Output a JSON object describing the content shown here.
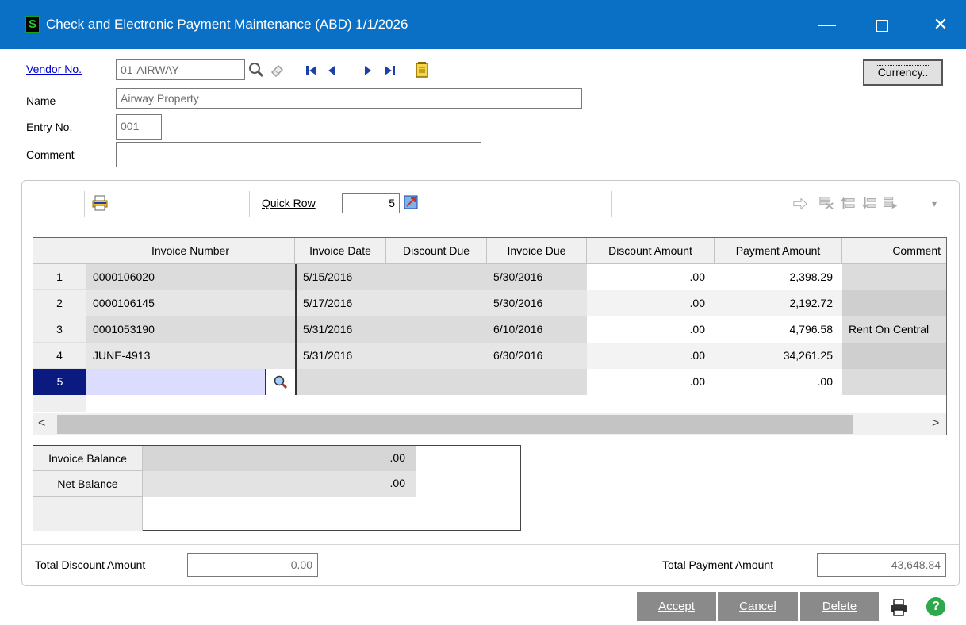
{
  "window": {
    "app_icon": "S",
    "title": "Check and Electronic Payment Maintenance (ABD) 1/1/2026",
    "minimize_glyph": "—",
    "close_glyph": "✕"
  },
  "header": {
    "vendor_label": "Vendor No.",
    "vendor_value": "01-AIRWAY",
    "name_label": "Name",
    "name_value": "Airway Property",
    "entry_label": "Entry No.",
    "entry_value": "001",
    "comment_label": "Comment",
    "comment_value": "",
    "currency_button": "Currency.."
  },
  "toolbar": {
    "quick_row_label": "Quick Row",
    "quick_row_value": "5",
    "dropdown_glyph": "▾"
  },
  "grid": {
    "columns": [
      "Invoice Number",
      "Invoice Date",
      "Discount Due",
      "Invoice Due",
      "Discount Amount",
      "Payment Amount",
      "Comment"
    ],
    "rows": [
      {
        "num": "1",
        "invoice_number": "0000106020",
        "invoice_date": "5/15/2016",
        "discount_due": "",
        "invoice_due": "5/30/2016",
        "discount_amount": ".00",
        "payment_amount": "2,398.29",
        "comment": ""
      },
      {
        "num": "2",
        "invoice_number": "0000106145",
        "invoice_date": "5/17/2016",
        "discount_due": "",
        "invoice_due": "5/30/2016",
        "discount_amount": ".00",
        "payment_amount": "2,192.72",
        "comment": ""
      },
      {
        "num": "3",
        "invoice_number": "0001053190",
        "invoice_date": "5/31/2016",
        "discount_due": "",
        "invoice_due": "6/10/2016",
        "discount_amount": ".00",
        "payment_amount": "4,796.58",
        "comment": "Rent On Central"
      },
      {
        "num": "4",
        "invoice_number": "JUNE-4913",
        "invoice_date": "5/31/2016",
        "discount_due": "",
        "invoice_due": "6/30/2016",
        "discount_amount": ".00",
        "payment_amount": "34,261.25",
        "comment": ""
      },
      {
        "num": "5",
        "invoice_number": "",
        "invoice_date": "",
        "discount_due": "",
        "invoice_due": "",
        "discount_amount": ".00",
        "payment_amount": ".00",
        "comment": ""
      }
    ],
    "scroll_left": "<",
    "scroll_right": ">"
  },
  "balances": {
    "invoice_balance_label": "Invoice Balance",
    "invoice_balance_value": ".00",
    "net_balance_label": "Net Balance",
    "net_balance_value": ".00"
  },
  "totals": {
    "total_discount_label": "Total Discount Amount",
    "total_discount_value": "0.00",
    "total_payment_label": "Total Payment Amount",
    "total_payment_value": "43,648.84"
  },
  "buttons": {
    "accept": "Accept",
    "cancel": "Cancel",
    "delete": "Delete"
  },
  "icons": {
    "lookup": "magnifier-icon",
    "clear": "eraser-icon",
    "first": "first-record-icon",
    "prev": "previous-record-icon",
    "next": "next-record-icon",
    "last": "last-record-icon",
    "memo": "memo-icon",
    "printer": "printer-icon",
    "help": "help-icon"
  },
  "colors": {
    "titlebar": "#0a70c6",
    "selected_row": "#0a1a80",
    "input_highlight": "#dcdcff",
    "button_gray": "#8a8a8a",
    "help_green": "#2ea84a"
  }
}
